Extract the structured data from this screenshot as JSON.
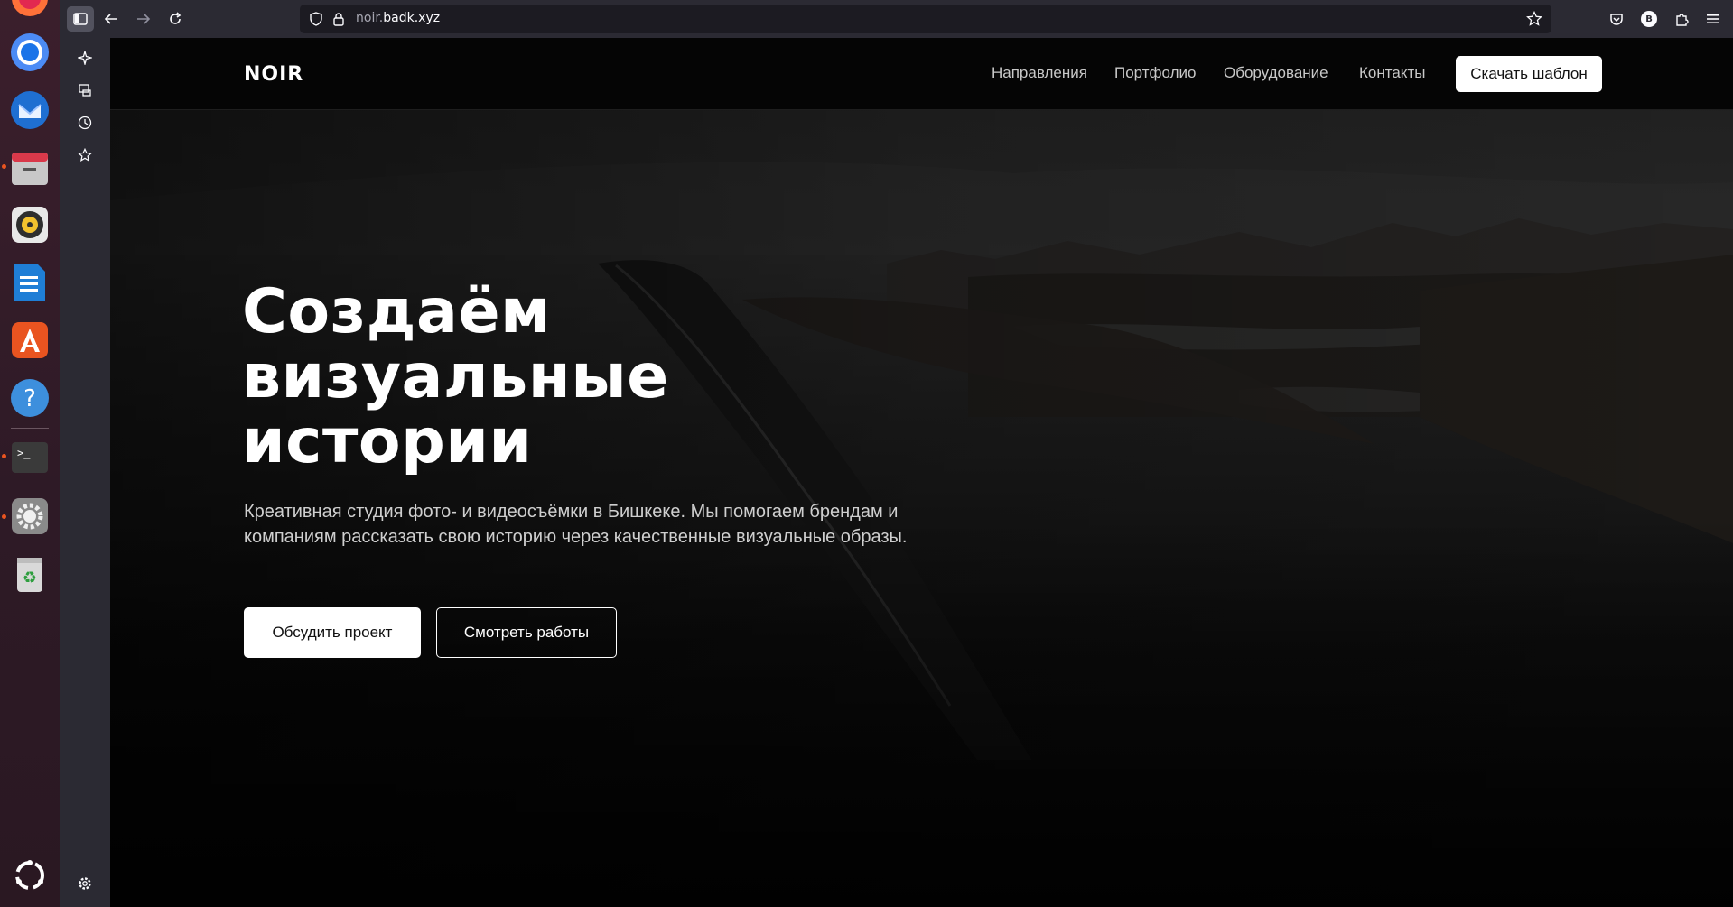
{
  "browser": {
    "url_host_prefix": "noir.",
    "url_host_main": "badk.xyz",
    "profile_initial": "B"
  },
  "dock": {
    "items": [
      "firefox-icon",
      "chromium-icon",
      "thunderbird-icon",
      "files-icon",
      "rhythmbox-icon",
      "writer-icon",
      "app-center-icon",
      "help-icon",
      "terminal-icon",
      "settings-icon",
      "trash-icon",
      "show-apps-icon"
    ]
  },
  "site": {
    "logo": "NOIR",
    "nav": [
      "Направления",
      "Портфолио",
      "Оборудование",
      "Контакты"
    ],
    "cta": "Скачать шаблон",
    "hero": {
      "title_line1": "Создаём",
      "title_line2": "визуальные",
      "title_line3": "истории",
      "subtitle": "Креативная студия фото- и видеосъёмки в Бишкеке. Мы помогаем брендам и компаниям рассказать свою историю через качественные визуальные образы.",
      "primary_button": "Обсудить проект",
      "secondary_button": "Смотреть работы"
    }
  },
  "colors": {
    "accent_orange": "#e95420",
    "toolbar": "#2b2a33",
    "page_bg": "#0a0a0a"
  }
}
